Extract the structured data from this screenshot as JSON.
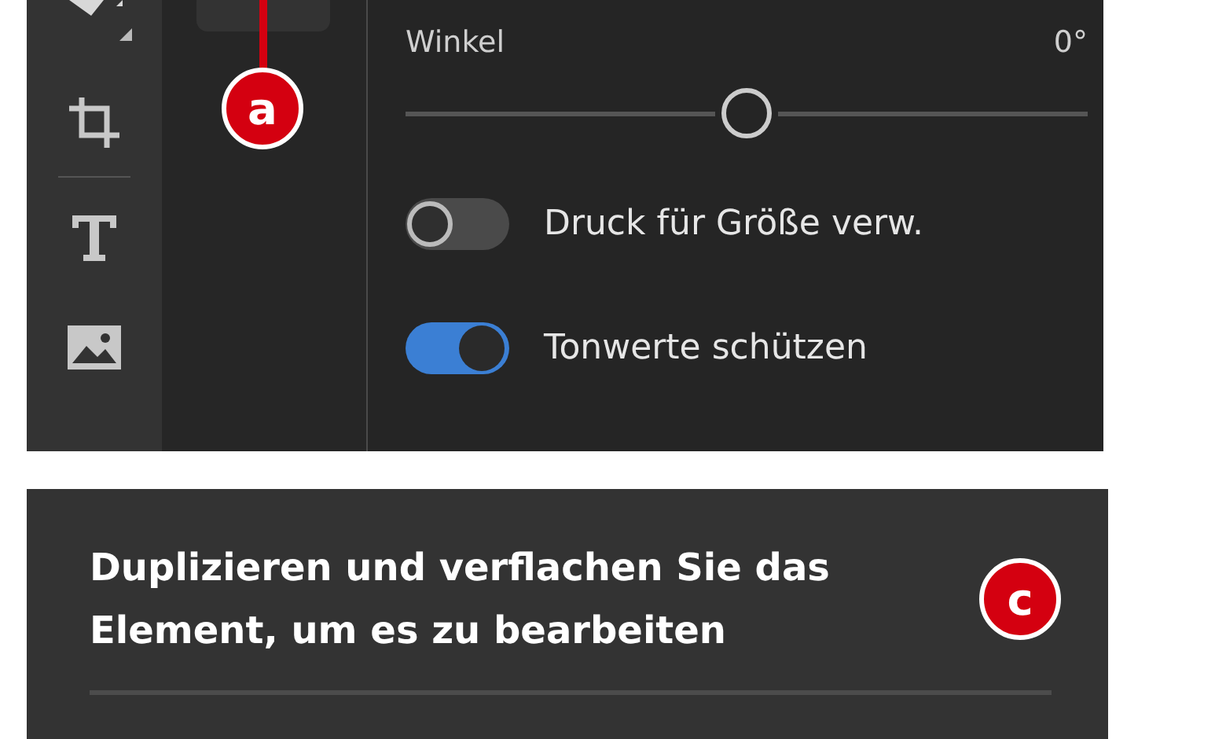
{
  "properties_panel": {
    "angle": {
      "label": "Winkel",
      "reading": "0°",
      "level": 0.5
    },
    "toggles": [
      {
        "label": "Druck für Größe verw.",
        "on": false
      },
      {
        "label": "Tonwerte schützen",
        "on": true
      }
    ]
  },
  "annotations": [
    {
      "label": "a"
    },
    {
      "label": "c"
    }
  ],
  "message_panel": {
    "text": "Duplizieren und verflachen Sie das Element, um es zu bearbeiten"
  }
}
